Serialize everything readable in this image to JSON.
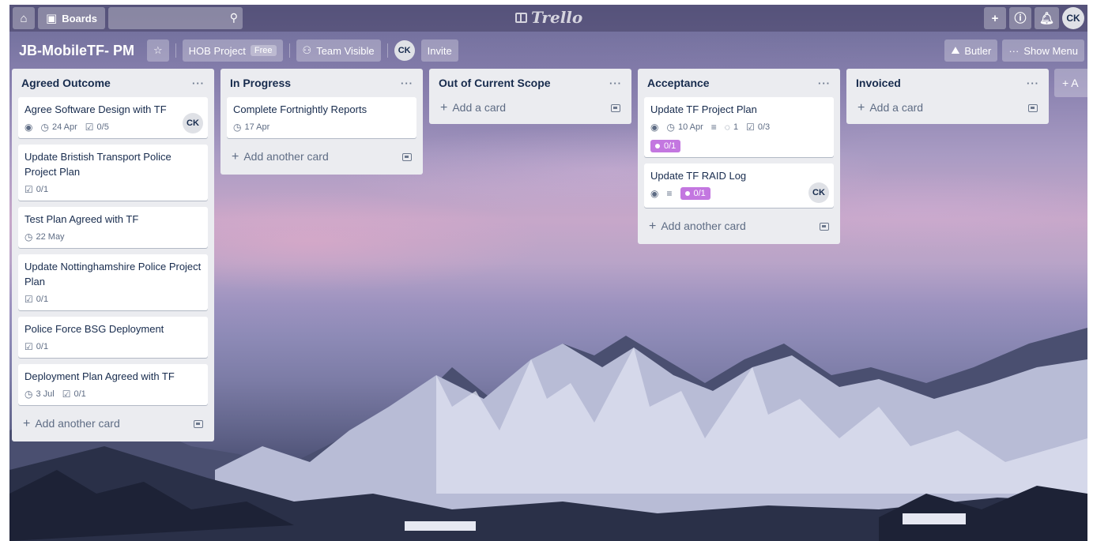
{
  "header": {
    "boards_label": "Boards",
    "logo_text": "Trello",
    "user_initials": "CK"
  },
  "board": {
    "title": "JB-MobileTF- PM",
    "team_label": "HOB Project",
    "plan_badge": "Free",
    "visibility_label": "Team Visible",
    "member_initials": "CK",
    "invite_label": "Invite",
    "butler_label": "Butler",
    "show_menu_label": "Show Menu",
    "add_list_label": "+ A"
  },
  "lists": [
    {
      "title": "Agreed Outcome",
      "add_label": "Add another card",
      "cards": [
        {
          "title": "Agree Software Design with TF",
          "watch": true,
          "due": "24 Apr",
          "checklist": "0/5",
          "member": "CK"
        },
        {
          "title": "Update Bristish Transport Police Project Plan",
          "checklist": "0/1"
        },
        {
          "title": "Test Plan Agreed with TF",
          "due": "22 May"
        },
        {
          "title": "Update Nottinghamshire Police Project Plan",
          "checklist": "0/1"
        },
        {
          "title": "Police Force BSG Deployment",
          "checklist": "0/1"
        },
        {
          "title": "Deployment Plan Agreed with TF",
          "due": "3 Jul",
          "checklist": "0/1"
        }
      ]
    },
    {
      "title": "In Progress",
      "add_label": "Add another card",
      "cards": [
        {
          "title": "Complete Fortnightly Reports",
          "due": "17 Apr"
        }
      ]
    },
    {
      "title": "Out of Current Scope",
      "add_label": "Add a card",
      "cards": []
    },
    {
      "title": "Acceptance",
      "add_label": "Add another card",
      "cards": [
        {
          "title": "Update TF Project Plan",
          "watch": true,
          "due": "10 Apr",
          "description": true,
          "comments": "1",
          "checklist": "0/3",
          "label_pill": "0/1"
        },
        {
          "title": "Update TF RAID Log",
          "watch": true,
          "description": true,
          "label_pill": "0/1",
          "member": "CK"
        }
      ]
    },
    {
      "title": "Invoiced",
      "add_label": "Add a card",
      "cards": []
    }
  ],
  "colors": {
    "label_purple": "#c377e0",
    "list_bg": "#ebecf0"
  }
}
